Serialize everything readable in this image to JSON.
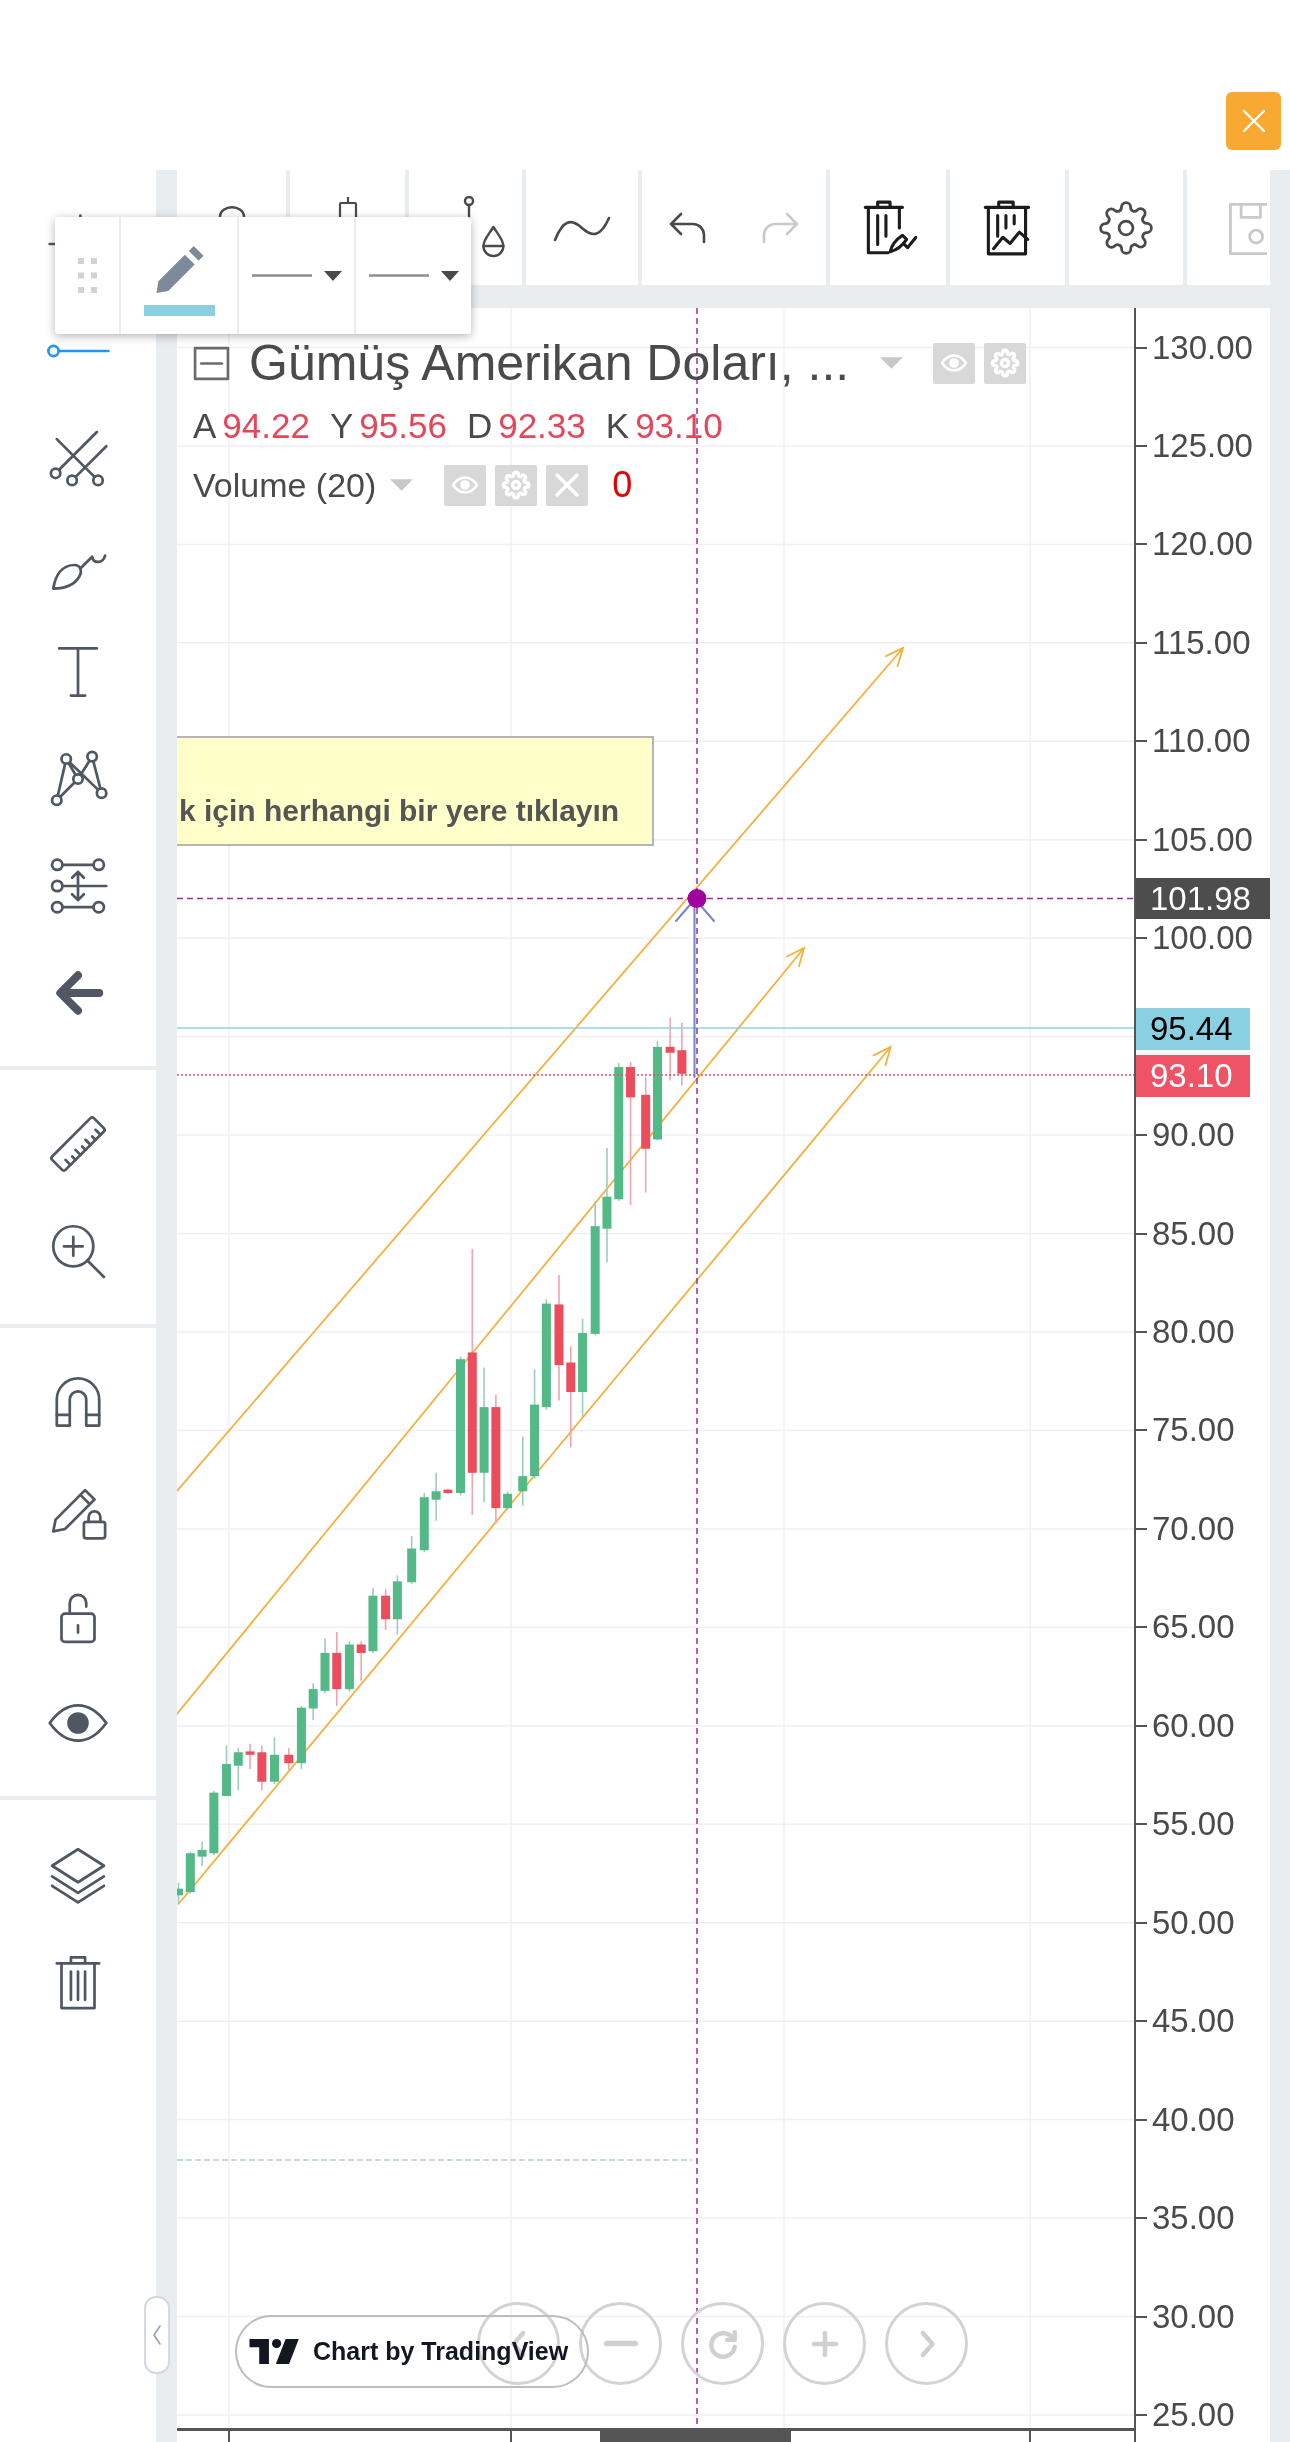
{
  "top_toolbar": {
    "buttons": [
      {
        "kind": "chart-style",
        "disabled": false
      },
      {
        "kind": "candles",
        "disabled": false
      },
      {
        "kind": "indicators",
        "disabled": false
      },
      {
        "kind": "wave",
        "disabled": false
      },
      {
        "kind": "undo",
        "disabled": false
      },
      {
        "kind": "redo",
        "disabled": true
      },
      {
        "kind": "clear-drawings",
        "disabled": false
      },
      {
        "kind": "clear-all",
        "disabled": false
      },
      {
        "kind": "settings",
        "disabled": false
      },
      {
        "kind": "save",
        "disabled": true
      }
    ]
  },
  "left_toolbar": {
    "groups": [
      {
        "items": [
          {
            "kind": "cross",
            "selected": false
          },
          {
            "kind": "horizontal-line",
            "selected": true
          },
          {
            "kind": "fib",
            "selected": false
          },
          {
            "kind": "brush",
            "selected": false
          },
          {
            "kind": "text",
            "selected": false
          },
          {
            "kind": "pattern",
            "selected": false
          },
          {
            "kind": "range",
            "selected": false
          },
          {
            "kind": "arrow",
            "selected": false
          }
        ]
      },
      {
        "items": [
          {
            "kind": "ruler",
            "selected": false
          },
          {
            "kind": "zoom",
            "selected": false
          }
        ]
      },
      {
        "items": [
          {
            "kind": "magnet",
            "selected": false
          },
          {
            "kind": "pencil-lock",
            "selected": false
          },
          {
            "kind": "lock",
            "selected": false
          },
          {
            "kind": "eye",
            "selected": false
          }
        ]
      },
      {
        "items": [
          {
            "kind": "layers",
            "selected": false
          },
          {
            "kind": "trash",
            "selected": false
          }
        ]
      }
    ]
  },
  "legend": {
    "title": "Gümüş Amerikan Doları, ...",
    "ohlc": [
      {
        "label": "A",
        "value": "94.22"
      },
      {
        "label": "Y",
        "value": "95.56"
      },
      {
        "label": "D",
        "value": "92.33"
      },
      {
        "label": "K",
        "value": "93.10"
      }
    ],
    "indicators": [
      {
        "name": "Volume (20)",
        "value": "0"
      }
    ]
  },
  "hint": {
    "text": "k için herhangi bir yere tıklayın"
  },
  "price_axis": {
    "labels": [
      "130.00",
      "125.00",
      "120.00",
      "115.00",
      "110.00",
      "105.00",
      "100.00",
      "90.00",
      "85.00",
      "80.00",
      "75.00",
      "70.00",
      "65.00",
      "60.00",
      "55.00",
      "50.00",
      "45.00",
      "40.00",
      "35.00",
      "30.00",
      "25.00"
    ],
    "markers": [
      {
        "kind": "crosshair",
        "text": "101.98"
      },
      {
        "kind": "line",
        "text": "95.44"
      },
      {
        "kind": "last",
        "text": "93.10"
      }
    ]
  },
  "attribution": {
    "text": "Chart by TradingView"
  }
}
